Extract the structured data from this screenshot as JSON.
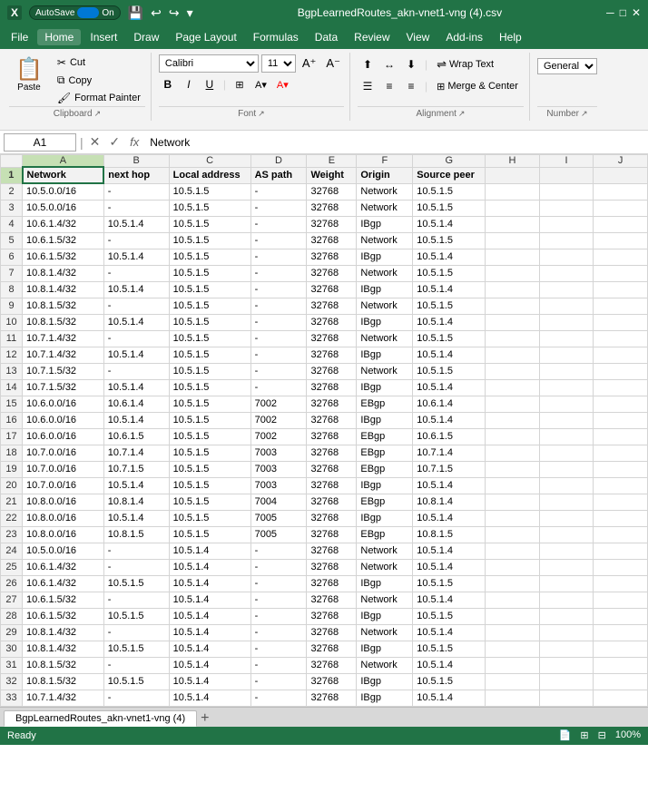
{
  "titlebar": {
    "autosave_label": "AutoSave",
    "autosave_state": "On",
    "filename": "BgpLearnedRoutes_akn-vnet1-vng (4).csv",
    "undo_icon": "↩",
    "redo_icon": "↪"
  },
  "menu": {
    "items": [
      "File",
      "Home",
      "Insert",
      "Draw",
      "Page Layout",
      "Formulas",
      "Data",
      "Review",
      "View",
      "Add-ins",
      "Help"
    ]
  },
  "ribbon": {
    "clipboard_group": "Clipboard",
    "paste_label": "Paste",
    "cut_label": "Cut",
    "copy_label": "Copy",
    "format_painter_label": "Format Painter",
    "font_group": "Font",
    "font_name": "Calibri",
    "font_size": "11",
    "bold": "B",
    "italic": "I",
    "underline": "U",
    "alignment_group": "Alignment",
    "wrap_text": "Wrap Text",
    "merge_center": "Merge & Center",
    "general_label": "Gener...",
    "number_group": "Number"
  },
  "formula_bar": {
    "cell_ref": "A1",
    "formula_text": "Network",
    "fx_label": "fx"
  },
  "columns": {
    "headers": [
      "",
      "A",
      "B",
      "C",
      "D",
      "E",
      "F",
      "G",
      "H",
      "I",
      "J"
    ]
  },
  "table": {
    "header_row": [
      "Network",
      "next hop",
      "Local address",
      "AS path",
      "Weight",
      "Origin",
      "Source peer",
      "",
      "",
      ""
    ],
    "rows": [
      [
        "2",
        "10.5.0.0/16",
        "-",
        "10.5.1.5",
        "-",
        "32768",
        "Network",
        "10.5.1.5",
        "",
        "",
        ""
      ],
      [
        "3",
        "10.5.0.0/16",
        "-",
        "10.5.1.5",
        "-",
        "32768",
        "Network",
        "10.5.1.5",
        "",
        "",
        ""
      ],
      [
        "4",
        "10.6.1.4/32",
        "10.5.1.4",
        "10.5.1.5",
        "-",
        "32768",
        "IBgp",
        "10.5.1.4",
        "",
        "",
        ""
      ],
      [
        "5",
        "10.6.1.5/32",
        "-",
        "10.5.1.5",
        "-",
        "32768",
        "Network",
        "10.5.1.5",
        "",
        "",
        ""
      ],
      [
        "6",
        "10.6.1.5/32",
        "10.5.1.4",
        "10.5.1.5",
        "-",
        "32768",
        "IBgp",
        "10.5.1.4",
        "",
        "",
        ""
      ],
      [
        "7",
        "10.8.1.4/32",
        "-",
        "10.5.1.5",
        "-",
        "32768",
        "Network",
        "10.5.1.5",
        "",
        "",
        ""
      ],
      [
        "8",
        "10.8.1.4/32",
        "10.5.1.4",
        "10.5.1.5",
        "-",
        "32768",
        "IBgp",
        "10.5.1.4",
        "",
        "",
        ""
      ],
      [
        "9",
        "10.8.1.5/32",
        "-",
        "10.5.1.5",
        "-",
        "32768",
        "Network",
        "10.5.1.5",
        "",
        "",
        ""
      ],
      [
        "10",
        "10.8.1.5/32",
        "10.5.1.4",
        "10.5.1.5",
        "-",
        "32768",
        "IBgp",
        "10.5.1.4",
        "",
        "",
        ""
      ],
      [
        "11",
        "10.7.1.4/32",
        "-",
        "10.5.1.5",
        "-",
        "32768",
        "Network",
        "10.5.1.5",
        "",
        "",
        ""
      ],
      [
        "12",
        "10.7.1.4/32",
        "10.5.1.4",
        "10.5.1.5",
        "-",
        "32768",
        "IBgp",
        "10.5.1.4",
        "",
        "",
        ""
      ],
      [
        "13",
        "10.7.1.5/32",
        "-",
        "10.5.1.5",
        "-",
        "32768",
        "Network",
        "10.5.1.5",
        "",
        "",
        ""
      ],
      [
        "14",
        "10.7.1.5/32",
        "10.5.1.4",
        "10.5.1.5",
        "-",
        "32768",
        "IBgp",
        "10.5.1.4",
        "",
        "",
        ""
      ],
      [
        "15",
        "10.6.0.0/16",
        "10.6.1.4",
        "10.5.1.5",
        "7002",
        "32768",
        "EBgp",
        "10.6.1.4",
        "",
        "",
        ""
      ],
      [
        "16",
        "10.6.0.0/16",
        "10.5.1.4",
        "10.5.1.5",
        "7002",
        "32768",
        "IBgp",
        "10.5.1.4",
        "",
        "",
        ""
      ],
      [
        "17",
        "10.6.0.0/16",
        "10.6.1.5",
        "10.5.1.5",
        "7002",
        "32768",
        "EBgp",
        "10.6.1.5",
        "",
        "",
        ""
      ],
      [
        "18",
        "10.7.0.0/16",
        "10.7.1.4",
        "10.5.1.5",
        "7003",
        "32768",
        "EBgp",
        "10.7.1.4",
        "",
        "",
        ""
      ],
      [
        "19",
        "10.7.0.0/16",
        "10.7.1.5",
        "10.5.1.5",
        "7003",
        "32768",
        "EBgp",
        "10.7.1.5",
        "",
        "",
        ""
      ],
      [
        "20",
        "10.7.0.0/16",
        "10.5.1.4",
        "10.5.1.5",
        "7003",
        "32768",
        "IBgp",
        "10.5.1.4",
        "",
        "",
        ""
      ],
      [
        "21",
        "10.8.0.0/16",
        "10.8.1.4",
        "10.5.1.5",
        "7004",
        "32768",
        "EBgp",
        "10.8.1.4",
        "",
        "",
        ""
      ],
      [
        "22",
        "10.8.0.0/16",
        "10.5.1.4",
        "10.5.1.5",
        "7005",
        "32768",
        "IBgp",
        "10.5.1.4",
        "",
        "",
        ""
      ],
      [
        "23",
        "10.8.0.0/16",
        "10.8.1.5",
        "10.5.1.5",
        "7005",
        "32768",
        "EBgp",
        "10.8.1.5",
        "",
        "",
        ""
      ],
      [
        "24",
        "10.5.0.0/16",
        "-",
        "10.5.1.4",
        "-",
        "32768",
        "Network",
        "10.5.1.4",
        "",
        "",
        ""
      ],
      [
        "25",
        "10.6.1.4/32",
        "-",
        "10.5.1.4",
        "-",
        "32768",
        "Network",
        "10.5.1.4",
        "",
        "",
        ""
      ],
      [
        "26",
        "10.6.1.4/32",
        "10.5.1.5",
        "10.5.1.4",
        "-",
        "32768",
        "IBgp",
        "10.5.1.5",
        "",
        "",
        ""
      ],
      [
        "27",
        "10.6.1.5/32",
        "-",
        "10.5.1.4",
        "-",
        "32768",
        "Network",
        "10.5.1.4",
        "",
        "",
        ""
      ],
      [
        "28",
        "10.6.1.5/32",
        "10.5.1.5",
        "10.5.1.4",
        "-",
        "32768",
        "IBgp",
        "10.5.1.5",
        "",
        "",
        ""
      ],
      [
        "29",
        "10.8.1.4/32",
        "-",
        "10.5.1.4",
        "-",
        "32768",
        "Network",
        "10.5.1.4",
        "",
        "",
        ""
      ],
      [
        "30",
        "10.8.1.4/32",
        "10.5.1.5",
        "10.5.1.4",
        "-",
        "32768",
        "IBgp",
        "10.5.1.5",
        "",
        "",
        ""
      ],
      [
        "31",
        "10.8.1.5/32",
        "-",
        "10.5.1.4",
        "-",
        "32768",
        "Network",
        "10.5.1.4",
        "",
        "",
        ""
      ],
      [
        "32",
        "10.8.1.5/32",
        "10.5.1.5",
        "10.5.1.4",
        "-",
        "32768",
        "IBgp",
        "10.5.1.5",
        "",
        "",
        ""
      ],
      [
        "33",
        "10.7.1.4/32",
        "-",
        "10.5.1.4",
        "-",
        "32768",
        "IBgp",
        "10.5.1.4",
        "",
        "",
        ""
      ]
    ]
  },
  "sheet_tab": "BgpLearnedRoutes_akn-vnet1-vng (4)",
  "status": "Ready"
}
